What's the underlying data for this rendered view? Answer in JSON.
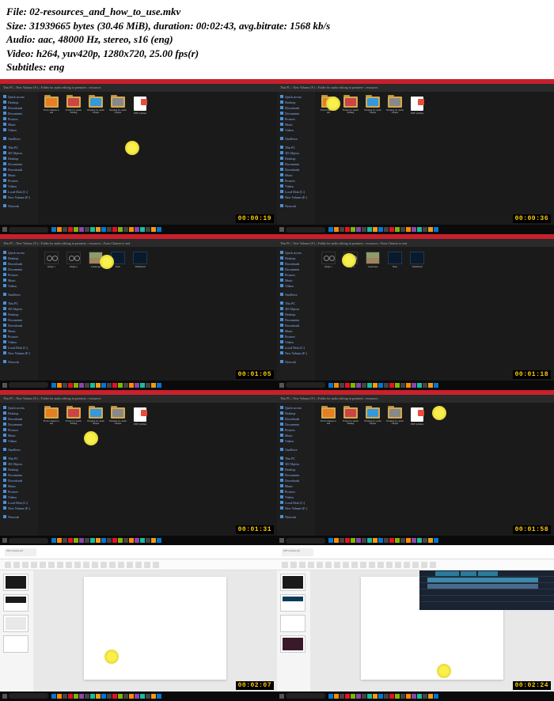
{
  "header": {
    "file_label": "File:",
    "file_value": "02-resources_and_how_to_use.mkv",
    "size_label": "Size:",
    "size_value": "31939665 bytes (30.46 MiB), duration: 00:02:43, avg.bitrate: 1568 kb/s",
    "audio_label": "Audio:",
    "audio_value": "aac, 48000 Hz, stereo, s16 (eng)",
    "video_label": "Video:",
    "video_value": "h264, yuv420p, 1280x720, 25.00 fps(r)",
    "subtitles_label": "Subtitles:",
    "subtitles_value": "eng"
  },
  "sidebar_items": [
    "Quick access",
    "Desktop",
    "Downloads",
    "Documents",
    "Pictures",
    "Music",
    "Videos",
    "",
    "OneDrive",
    "",
    "This PC",
    "3D Objects",
    "Desktop",
    "Documents",
    "Downloads",
    "Music",
    "Pictures",
    "Videos",
    "Local Disk (C:)",
    "New Volume (F:)",
    "",
    "Network"
  ],
  "folders_main": [
    "From Chinese to end",
    "Folder for Audio Editing",
    "Warping for audio chapter",
    "Warping for audio chapter",
    "PDF syllabus"
  ],
  "folders_resources": [
    "Image 1",
    "Image 2",
    "Landscape",
    "Dark",
    "Thumbnail"
  ],
  "breadcrumb_main": "This PC › New Volume (F:) › Folder for audio editing in premiere › resources",
  "breadcrumb_res": "This PC › New Volume (F:) › Folder for audio editing in premiere › resources › From Chinese to end",
  "search_placeholder": "Type here to search",
  "timestamps": [
    "00:00:19",
    "00:00:36",
    "00:01:05",
    "00:01:18",
    "00:01:31",
    "00:01:58",
    "00:02:07",
    "00:02:24"
  ],
  "pdf_tab": "PDF syllabus.pdf"
}
